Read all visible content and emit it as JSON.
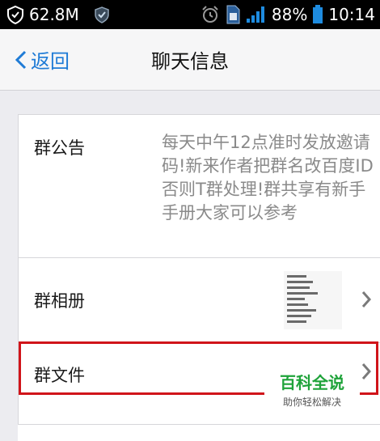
{
  "status_bar": {
    "overlay_text": "62.8M",
    "battery_percent": "88%",
    "time": "10:14",
    "icons": [
      "shield-icon",
      "shield-check-icon",
      "alarm-clock-icon",
      "sim-card-icon",
      "signal-icon",
      "battery-icon"
    ]
  },
  "nav": {
    "back_label": "返回",
    "title": "聊天信息"
  },
  "rows": {
    "notice": {
      "label": "群公告",
      "text": "每天中午12点准时发放邀请码!新来作者把群名改百度ID否则T群处理!群共享有新手手册大家可以参考"
    },
    "album": {
      "label": "群相册"
    },
    "files": {
      "label": "群文件"
    }
  },
  "watermark": {
    "main": "百科全说",
    "sub": "助你轻松解决"
  },
  "colors": {
    "accent": "#1f7bd6",
    "highlight": "#d0141a",
    "watermark_green": "#1fa33a"
  }
}
